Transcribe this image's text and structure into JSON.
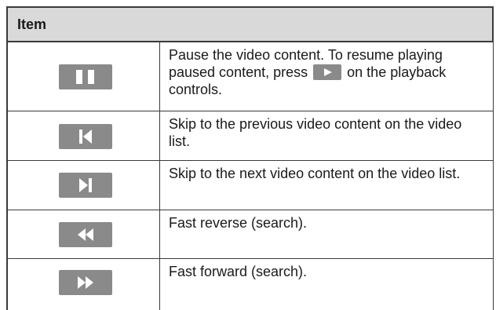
{
  "table": {
    "header": "Item",
    "rows": [
      {
        "icon": "pause-icon",
        "text_before": "Pause the video content. To resume playing paused content, press",
        "inline_icon": "play-icon",
        "text_after": "on the playback controls."
      },
      {
        "icon": "skip-previous-icon",
        "text": "Skip to the previous video content on the video list."
      },
      {
        "icon": "skip-next-icon",
        "text": "Skip to the next video content on the video list."
      },
      {
        "icon": "fast-reverse-icon",
        "text": "Fast reverse (search)."
      },
      {
        "icon": "fast-forward-icon",
        "text": "Fast forward (search)."
      }
    ]
  },
  "colors": {
    "header_bg": "#d9d9d9",
    "icon_bg": "#8a8a8a",
    "icon_fg": "#ffffff",
    "border": "#3a3a3a",
    "text": "#1a1a1a"
  }
}
